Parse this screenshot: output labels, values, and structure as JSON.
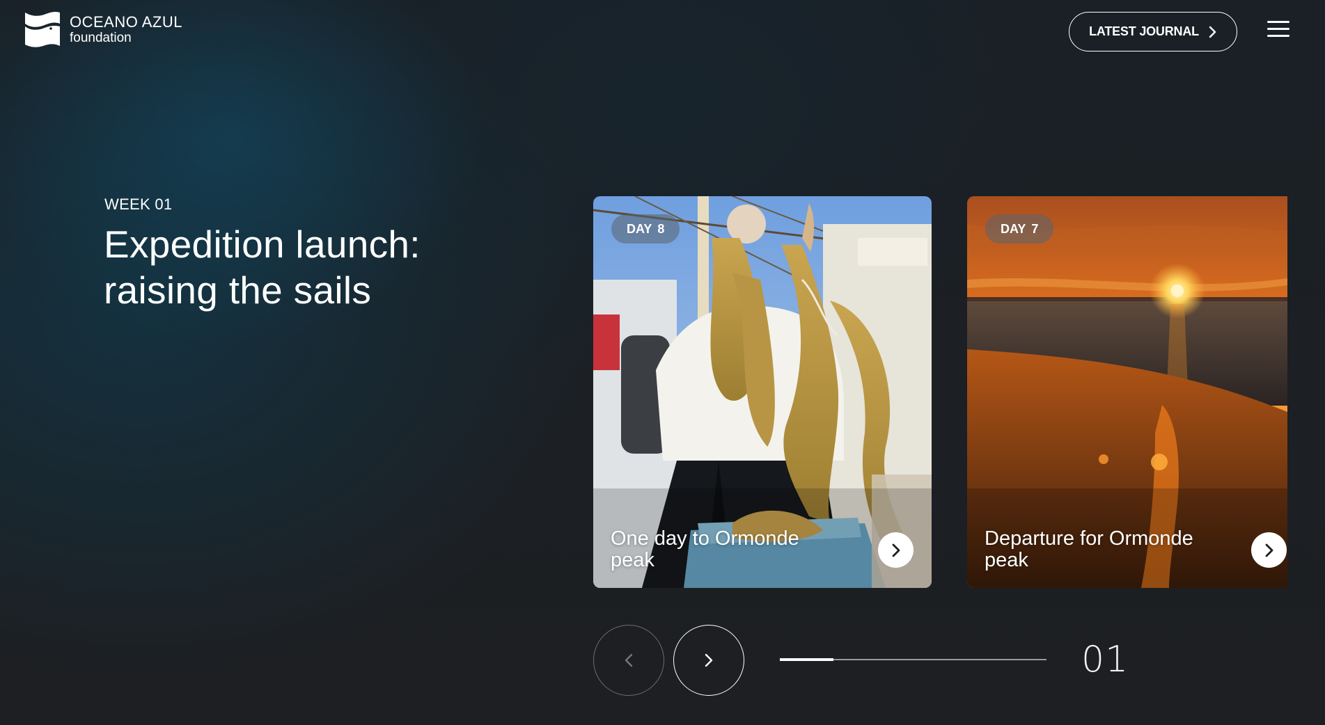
{
  "brand": {
    "name": "OCEANO AZUL",
    "subtitle": "foundation"
  },
  "header": {
    "journal_label": "LATEST JOURNAL",
    "journal_icon": "chevron-right-icon",
    "menu_icon": "hamburger-menu-icon"
  },
  "hero": {
    "week": "WEEK 01",
    "title": "Expedition launch: raising the sails"
  },
  "cards": [
    {
      "day_label": "DAY",
      "day_number": "8",
      "caption": "One day to Ormonde peak",
      "image": "crew-member-holding-kelp-on-ship-deck"
    },
    {
      "day_label": "DAY",
      "day_number": "7",
      "caption": "Departure for Ormonde peak",
      "image": "orange-sunset-over-sea"
    }
  ],
  "slider": {
    "counter": "01",
    "progress_fraction": 0.2,
    "prev_icon": "chevron-left-icon",
    "next_icon": "chevron-right-icon"
  },
  "colors": {
    "background": "#1b1e22",
    "ocean_glow": "#104c68",
    "text": "#ffffff"
  }
}
